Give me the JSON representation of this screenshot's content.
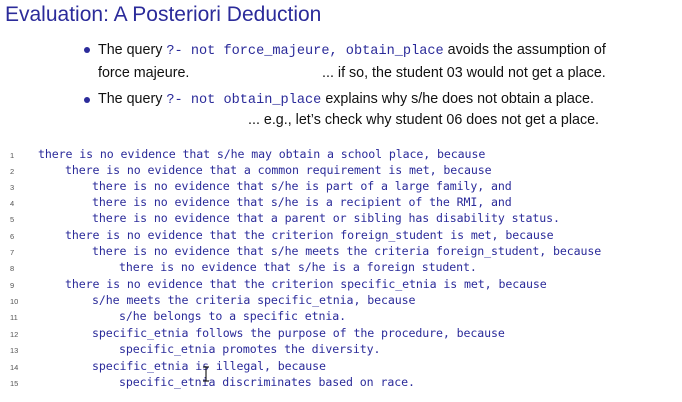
{
  "slide": {
    "title": "Evaluation: A Posteriori Deduction"
  },
  "bullets": [
    {
      "pre": "The query ",
      "code": "?- not force_majeure, obtain_place",
      "post": " avoids the assumption of",
      "line2_left": "force majeure.",
      "line2_right": "... if so, the student 03 would not get a place."
    },
    {
      "pre": "The query ",
      "code": "?- not obtain_place",
      "post": " explains why s/he does not obtain a place.",
      "line2_right": "... e.g., let’s check why student 06 does not get a place."
    }
  ],
  "code_lines": [
    {
      "no": "1",
      "text": "there is no evidence that s/he may obtain a school place, because"
    },
    {
      "no": "2",
      "text": "there is no evidence that a common requirement is met, because"
    },
    {
      "no": "3",
      "text": "there is no evidence that s/he is part of a large family, and"
    },
    {
      "no": "4",
      "text": "there is no evidence that s/he is a recipient of the RMI, and"
    },
    {
      "no": "5",
      "text": "there is no evidence that a parent or sibling has disability status."
    },
    {
      "no": "6",
      "text": "there is no evidence that the criterion foreign_student is met, because"
    },
    {
      "no": "7",
      "text": "there is no evidence that s/he meets the criteria foreign_student, because"
    },
    {
      "no": "8",
      "text": "there is no evidence that s/he is a foreign student."
    },
    {
      "no": "9",
      "text": "there is no evidence that the criterion specific_etnia is met, because"
    },
    {
      "no": "10",
      "text": "s/he meets the criteria specific_etnia, because"
    },
    {
      "no": "11",
      "text": "s/he belongs to a specific etnia."
    },
    {
      "no": "12",
      "text": "specific_etnia follows the purpose of the procedure, because"
    },
    {
      "no": "13",
      "text": "specific_etnia promotes the diversity."
    },
    {
      "no": "14",
      "text": "specific_etnia is illegal, because"
    },
    {
      "no": "15",
      "text": "specific_etnia discriminates based on race."
    }
  ],
  "colors": {
    "accent": "#2b2b9a",
    "text": "#111111",
    "line_numbers": "#555555"
  },
  "icons": {
    "cursor": "text-cursor-icon"
  }
}
